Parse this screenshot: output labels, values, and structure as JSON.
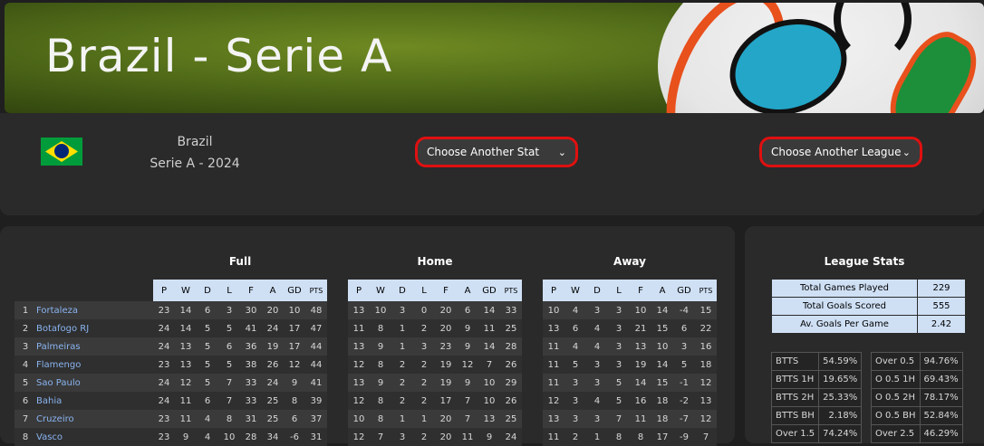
{
  "banner": {
    "title": "Brazil - Serie A"
  },
  "info": {
    "country": "Brazil",
    "season": "Serie A - 2024"
  },
  "selects": {
    "stat": "Choose Another Stat",
    "league": "Choose Another League"
  },
  "sections": {
    "full": "Full",
    "home": "Home",
    "away": "Away",
    "league_stats": "League Stats"
  },
  "columns": [
    "P",
    "W",
    "D",
    "L",
    "F",
    "A",
    "GD",
    "PTS"
  ],
  "teams": [
    {
      "pos": "1",
      "name": "Fortaleza"
    },
    {
      "pos": "2",
      "name": "Botafogo RJ"
    },
    {
      "pos": "3",
      "name": "Palmeiras"
    },
    {
      "pos": "4",
      "name": "Flamengo"
    },
    {
      "pos": "5",
      "name": "Sao Paulo"
    },
    {
      "pos": "6",
      "name": "Bahia"
    },
    {
      "pos": "7",
      "name": "Cruzeiro"
    },
    {
      "pos": "8",
      "name": "Vasco"
    }
  ],
  "full": [
    [
      "23",
      "14",
      "6",
      "3",
      "30",
      "20",
      "10",
      "48"
    ],
    [
      "24",
      "14",
      "5",
      "5",
      "41",
      "24",
      "17",
      "47"
    ],
    [
      "24",
      "13",
      "5",
      "6",
      "36",
      "19",
      "17",
      "44"
    ],
    [
      "23",
      "13",
      "5",
      "5",
      "38",
      "26",
      "12",
      "44"
    ],
    [
      "24",
      "12",
      "5",
      "7",
      "33",
      "24",
      "9",
      "41"
    ],
    [
      "24",
      "11",
      "6",
      "7",
      "33",
      "25",
      "8",
      "39"
    ],
    [
      "23",
      "11",
      "4",
      "8",
      "31",
      "25",
      "6",
      "37"
    ],
    [
      "23",
      "9",
      "4",
      "10",
      "28",
      "34",
      "-6",
      "31"
    ]
  ],
  "home": [
    [
      "13",
      "10",
      "3",
      "0",
      "20",
      "6",
      "14",
      "33"
    ],
    [
      "11",
      "8",
      "1",
      "2",
      "20",
      "9",
      "11",
      "25"
    ],
    [
      "13",
      "9",
      "1",
      "3",
      "23",
      "9",
      "14",
      "28"
    ],
    [
      "12",
      "8",
      "2",
      "2",
      "19",
      "12",
      "7",
      "26"
    ],
    [
      "13",
      "9",
      "2",
      "2",
      "19",
      "9",
      "10",
      "29"
    ],
    [
      "12",
      "8",
      "2",
      "2",
      "17",
      "7",
      "10",
      "26"
    ],
    [
      "10",
      "8",
      "1",
      "1",
      "20",
      "7",
      "13",
      "25"
    ],
    [
      "12",
      "7",
      "3",
      "2",
      "20",
      "11",
      "9",
      "24"
    ]
  ],
  "away": [
    [
      "10",
      "4",
      "3",
      "3",
      "10",
      "14",
      "-4",
      "15"
    ],
    [
      "13",
      "6",
      "4",
      "3",
      "21",
      "15",
      "6",
      "22"
    ],
    [
      "11",
      "4",
      "4",
      "3",
      "13",
      "10",
      "3",
      "16"
    ],
    [
      "11",
      "5",
      "3",
      "3",
      "19",
      "14",
      "5",
      "18"
    ],
    [
      "11",
      "3",
      "3",
      "5",
      "14",
      "15",
      "-1",
      "12"
    ],
    [
      "12",
      "3",
      "4",
      "5",
      "16",
      "18",
      "-2",
      "13"
    ],
    [
      "13",
      "3",
      "3",
      "7",
      "11",
      "18",
      "-7",
      "12"
    ],
    [
      "11",
      "2",
      "1",
      "8",
      "8",
      "17",
      "-9",
      "7"
    ]
  ],
  "league_stats": [
    {
      "label": "Total Games Played",
      "value": "229"
    },
    {
      "label": "Total Goals Scored",
      "value": "555"
    },
    {
      "label": "Av. Goals Per Game",
      "value": "2.42"
    }
  ],
  "btts": [
    {
      "label": "BTTS",
      "value": "54.59%"
    },
    {
      "label": "BTTS 1H",
      "value": "19.65%"
    },
    {
      "label": "BTTS 2H",
      "value": "25.33%"
    },
    {
      "label": "BTTS BH",
      "value": "2.18%"
    },
    {
      "label": "Over 1.5",
      "value": "74.24%"
    }
  ],
  "overs": [
    {
      "label": "Over 0.5",
      "value": "94.76%"
    },
    {
      "label": "O 0.5 1H",
      "value": "69.43%"
    },
    {
      "label": "O 0.5 2H",
      "value": "78.17%"
    },
    {
      "label": "O 0.5 BH",
      "value": "52.84%"
    },
    {
      "label": "Over 2.5",
      "value": "46.29%"
    }
  ],
  "colors": {
    "accent_red": "#e01010",
    "header_blue": "#cfe0f5",
    "team_link": "#8ab4f0"
  }
}
